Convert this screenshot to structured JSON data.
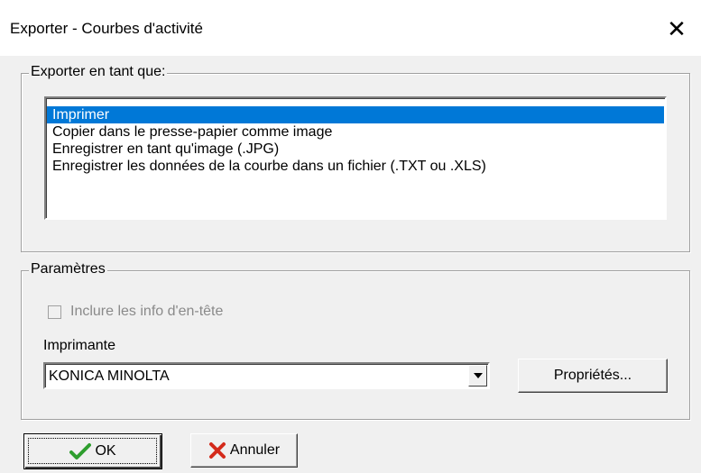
{
  "window": {
    "title": "Exporter - Courbes d'activité",
    "close_symbol": "✕"
  },
  "export_group": {
    "legend": "Exporter en tant que:",
    "items": [
      {
        "label": "Imprimer",
        "selected": true
      },
      {
        "label": "Copier dans le presse-papier comme image",
        "selected": false
      },
      {
        "label": "Enregistrer en tant qu'image (.JPG)",
        "selected": false
      },
      {
        "label": "Enregistrer les données de la courbe dans un fichier  (.TXT ou .XLS)",
        "selected": false
      }
    ]
  },
  "params_group": {
    "legend": "Paramètres",
    "include_header_label": "Inclure les info d'en-tête",
    "include_header_checked": false,
    "include_header_enabled": false,
    "printer_label": "Imprimante",
    "printer_value": "KONICA MINOLTA",
    "properties_button": "Propriétés..."
  },
  "buttons": {
    "ok": "OK",
    "cancel": "Annuler"
  },
  "colors": {
    "selection": "#0078d7",
    "ok_check": "#2e9e2e",
    "cancel_x": "#d42a1b"
  }
}
